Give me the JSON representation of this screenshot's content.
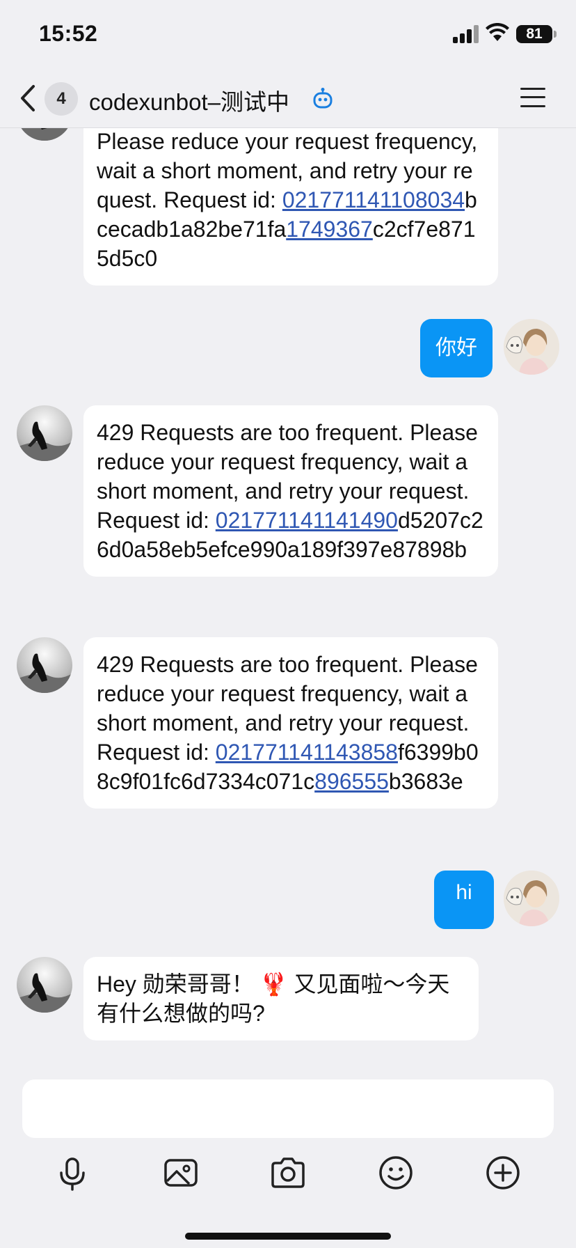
{
  "status_bar": {
    "time": "15:52",
    "battery": "81"
  },
  "nav": {
    "unread_count": "4",
    "title": "codexunbot–测试中",
    "bot_icon": "robot-icon",
    "menu_icon": "hamburger-menu-icon",
    "back_icon": "chevron-left-icon"
  },
  "messages": [
    {
      "sender": "bot",
      "parts": [
        {
          "text": "Please reduce your request frequency, wait a short moment, and retry your request. Request id: "
        },
        {
          "text": "021771141108034",
          "link": true
        },
        {
          "text": "bcecadb1a82be71fa"
        },
        {
          "text": "1749367",
          "link": true
        },
        {
          "text": "c2cf7e8715d5c0"
        }
      ]
    },
    {
      "sender": "user",
      "text": "你好"
    },
    {
      "sender": "bot",
      "parts": [
        {
          "text": "429 Requests are too frequent. Please reduce your request frequency, wait a short moment, and retry your request. Request id: "
        },
        {
          "text": "021771141141490",
          "link": true
        },
        {
          "text": "d5207c26d0a58eb5efce990a189f397e87898b"
        }
      ]
    },
    {
      "sender": "bot",
      "parts": [
        {
          "text": "429 Requests are too frequent. Please reduce your request frequency, wait a short moment, and retry your request. Request id: "
        },
        {
          "text": "021771141143858",
          "link": true
        },
        {
          "text": "f6399b08c9f01fc6d7334c071c"
        },
        {
          "text": "896555",
          "link": true
        },
        {
          "text": "b3683e"
        }
      ]
    },
    {
      "sender": "user",
      "text": "hi"
    },
    {
      "sender": "bot",
      "parts": [
        {
          "text": "Hey 勋荣哥哥！ 🦞 又见面啦～今天有什么想做的吗?"
        }
      ]
    }
  ],
  "toolbar": {
    "icons": [
      "microphone-icon",
      "image-icon",
      "camera-icon",
      "emoji-icon",
      "plus-icon"
    ]
  },
  "colors": {
    "outgoing_bubble": "#0a95f5",
    "link": "#2f57b3",
    "background": "#f0f0f3"
  }
}
